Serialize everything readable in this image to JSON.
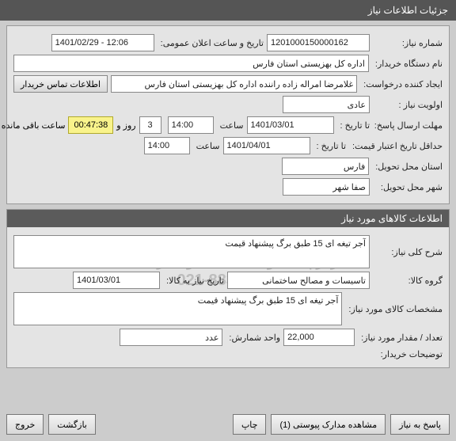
{
  "window": {
    "title": "جزئیات اطلاعات نیاز"
  },
  "need": {
    "number_label": "شماره نیاز:",
    "number": "1201000150000162",
    "announce_label": "تاریخ و ساعت اعلان عمومی:",
    "announce_value": "1401/02/29 - 12:06",
    "buyer_label": "نام دستگاه خریدار:",
    "buyer": "اداره کل بهزیستی استان فارس",
    "creator_label": "ایجاد کننده درخواست:",
    "creator": "غلامرضا امراله زاده راننده اداره کل بهزیستی استان فارس",
    "contact_btn": "اطلاعات تماس خریدار",
    "priority_label": "اولویت نیاز :",
    "priority": "عادی",
    "deadline_label": "مهلت ارسال پاسخ:",
    "to_date_label": "تا تاریخ :",
    "deadline_date": "1401/03/01",
    "time_label": "ساعت",
    "deadline_time": "14:00",
    "days_remaining": "3",
    "days_label": "روز و",
    "countdown": "00:47:38",
    "remaining_label": "ساعت باقی مانده",
    "validity_label": "حداقل تاریخ اعتبار قیمت:",
    "validity_date": "1401/04/01",
    "validity_time": "14:00",
    "province_label": "استان محل تحویل:",
    "province": "فارس",
    "city_label": "شهر محل تحویل:",
    "city": "صفا شهر"
  },
  "goods": {
    "header": "اطلاعات کالاهای مورد نیاز",
    "desc_label": "شرح کلی نیاز:",
    "desc": "آجر تیغه ای 15 طبق برگ پیشنهاد قیمت",
    "group_label": "گروه کالا:",
    "group": "تاسیسات و مصالح ساختمانی",
    "need_date_label": "تاریخ نیاز به کالا:",
    "need_date": "1401/03/01",
    "spec_label": "مشخصات کالای مورد نیاز:",
    "spec": "آجر تیغه ای 15 طبق برگ پیشنهاد قیمت",
    "qty_label": "تعداد / مقدار مورد نیاز:",
    "qty": "22,000",
    "unit_label": "واحد شمارش:",
    "unit": "عدد",
    "buyer_note_label": "توضیحات خریدار:"
  },
  "watermark": {
    "line1": "سامانه تدارکات الکترونیکی دولت",
    "line2": "مرکز پاسخگویی اطلاعات و مدارک اسناد",
    "phone": "021-88349670"
  },
  "actions": {
    "respond": "پاسخ به نیاز",
    "attachments": "مشاهده مدارک پیوستی (1)",
    "print": "چاپ",
    "back": "بازگشت",
    "exit": "خروج"
  }
}
